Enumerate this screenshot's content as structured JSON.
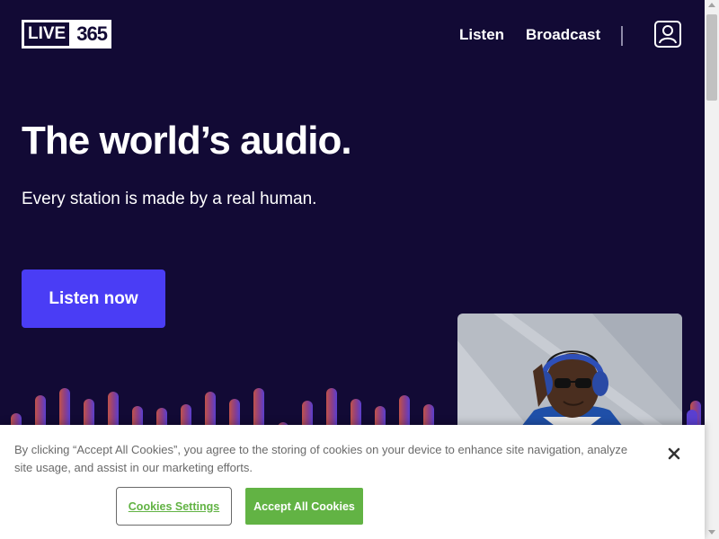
{
  "header": {
    "logo": {
      "word": "LIVE",
      "number": "365"
    },
    "nav": {
      "listen": "Listen",
      "broadcast": "Broadcast"
    },
    "account_icon": "user-icon"
  },
  "hero": {
    "title": "The world’s audio.",
    "subtitle": "Every station is made by a real human.",
    "cta_label": "Listen now",
    "photo": "person-with-headphones-photo"
  },
  "cookie_banner": {
    "text": "By clicking “Accept All Cookies”, you agree to the storing of cookies on your device to enhance site navigation, analyze site usage, and assist in our marketing efforts.",
    "settings_label": "Cookies Settings",
    "accept_label": "Accept All Cookies",
    "close_icon": "close-icon"
  },
  "colors": {
    "background": "#120a35",
    "cta": "#4a3df5",
    "accept": "#62b344",
    "wave_start": "#c0524a",
    "wave_end": "#5a3fd0"
  }
}
